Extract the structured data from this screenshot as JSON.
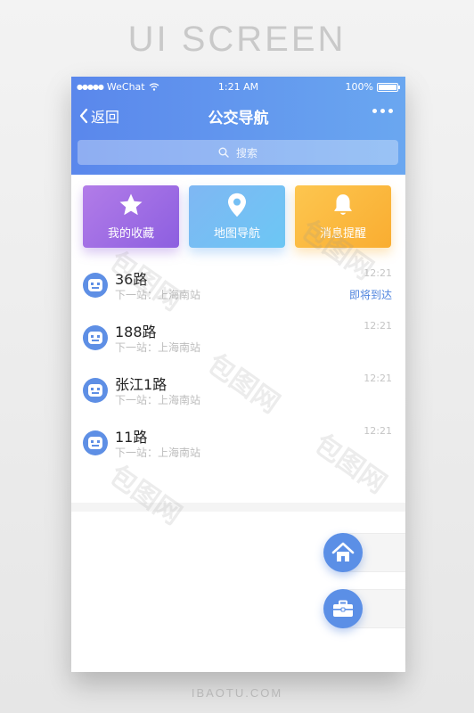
{
  "page": {
    "heading": "UI SCREEN",
    "credit": "IBAOTU.COM"
  },
  "status_bar": {
    "carrier": "WeChat",
    "time": "1:21 AM",
    "battery": "100%",
    "battery_level": 1.0
  },
  "nav": {
    "back_label": "返回",
    "title": "公交导航"
  },
  "search": {
    "placeholder": "搜索"
  },
  "quick_actions": [
    {
      "label": "我的收藏",
      "icon": "star-icon"
    },
    {
      "label": "地图导航",
      "icon": "map-pin-icon"
    },
    {
      "label": "消息提醒",
      "icon": "bell-icon"
    }
  ],
  "routes": [
    {
      "name": "36路",
      "next_stop": "下一站：上海南站",
      "time": "12:21",
      "status": "即将到达"
    },
    {
      "name": "188路",
      "next_stop": "下一站：上海南站",
      "time": "12:21",
      "status": ""
    },
    {
      "name": "张江1路",
      "next_stop": "下一站：上海南站",
      "time": "12:21",
      "status": ""
    },
    {
      "name": "11路",
      "next_stop": "下一站：上海南站",
      "time": "12:21",
      "status": ""
    }
  ],
  "fab": [
    {
      "icon": "home-icon"
    },
    {
      "icon": "briefcase-icon"
    }
  ],
  "watermark": {
    "text": "包图网"
  },
  "colors": {
    "header_start": "#5a87ec",
    "header_end": "#6aa7f0",
    "accent": "#4f84de",
    "fav_card": "#9b6be4",
    "map_card": "#74bff4",
    "msg_card": "#fbb93f"
  }
}
